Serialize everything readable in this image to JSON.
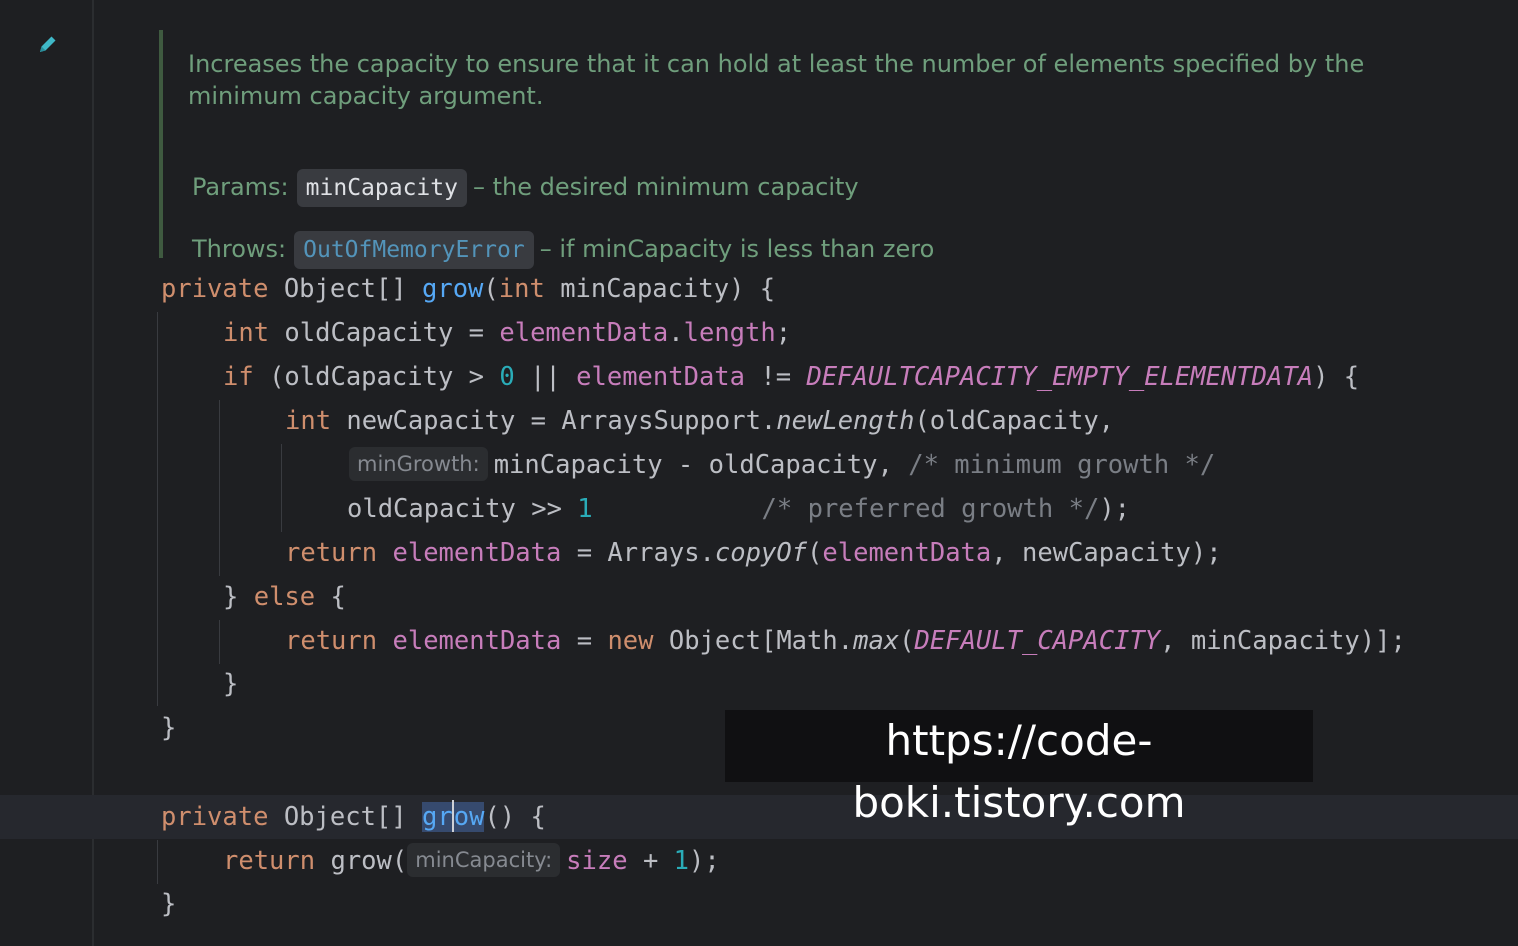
{
  "doc": {
    "description": "Increases the capacity to ensure that it can hold at least the number of elements specified by the minimum capacity argument.",
    "params_label": "Params:",
    "param_name": "minCapacity",
    "param_desc": "– the desired minimum capacity",
    "throws_label": "Throws:",
    "throws_type": "OutOfMemoryError",
    "throws_desc": "– if minCapacity is less than zero"
  },
  "code": {
    "t": {
      "private": "private",
      "object_arr": " Object[] ",
      "grow": "grow",
      "lp": "(",
      "int": "int",
      "min_cap_param": " minCapacity) {",
      "int_kw": "int",
      "old_cap_decl": " oldCapacity = ",
      "elementData": "elementData",
      "dot_length": ".",
      "length": "length",
      "semicolon": ";",
      "if": "if",
      "if_open": " (oldCapacity > ",
      "zero": "0",
      "or": " || ",
      "neq": " != ",
      "default_empty": "DEFAULTCAPACITY_EMPTY_ELEMENTDATA",
      "close_brace_open": ") {",
      "new_cap_decl": " newCapacity = ArraysSupport.",
      "newLength": "newLength",
      "new_len_args": "(oldCapacity,",
      "min_growth_hint": "minGrowth:",
      "min_growth_expr": "minCapacity - oldCapacity, ",
      "min_growth_cmt": "/* minimum growth */",
      "pref_expr": "oldCapacity >> ",
      "one": "1",
      "pref_pad": "           ",
      "pref_cmt": "/* preferred growth */",
      "pref_end": ");",
      "return": "return",
      "assign": " = Arrays.",
      "copyOf": "copyOf",
      "copy_args_open": "(",
      "copy_args_close": ", newCapacity);",
      "else_close": "} ",
      "else": "else",
      "else_open": " {",
      "new_kw": "new",
      "math_max_open": " Object[Math.",
      "max": "max",
      "default_cap": "DEFAULT_CAPACITY",
      "max_close": ", minCapacity)];",
      "brace_close": "}",
      "grow_gr": "gr",
      "grow_ow": "ow",
      "grow_empty": "() {",
      "grow_call": " grow(",
      "min_cap_hint": "minCapacity:",
      "size": "size",
      "plus": " + ",
      "call_end": ");"
    }
  },
  "watermark": "https://code-boki.tistory.com",
  "colors": {
    "keyword": "#cf8e6d",
    "function": "#56a8f5",
    "field": "#c77dbb",
    "number": "#2aacb8",
    "comment": "#7a7e85",
    "doc": "#6f9e7c",
    "background": "#1e1f22"
  },
  "icons": {
    "gutter": "pencil-icon"
  }
}
